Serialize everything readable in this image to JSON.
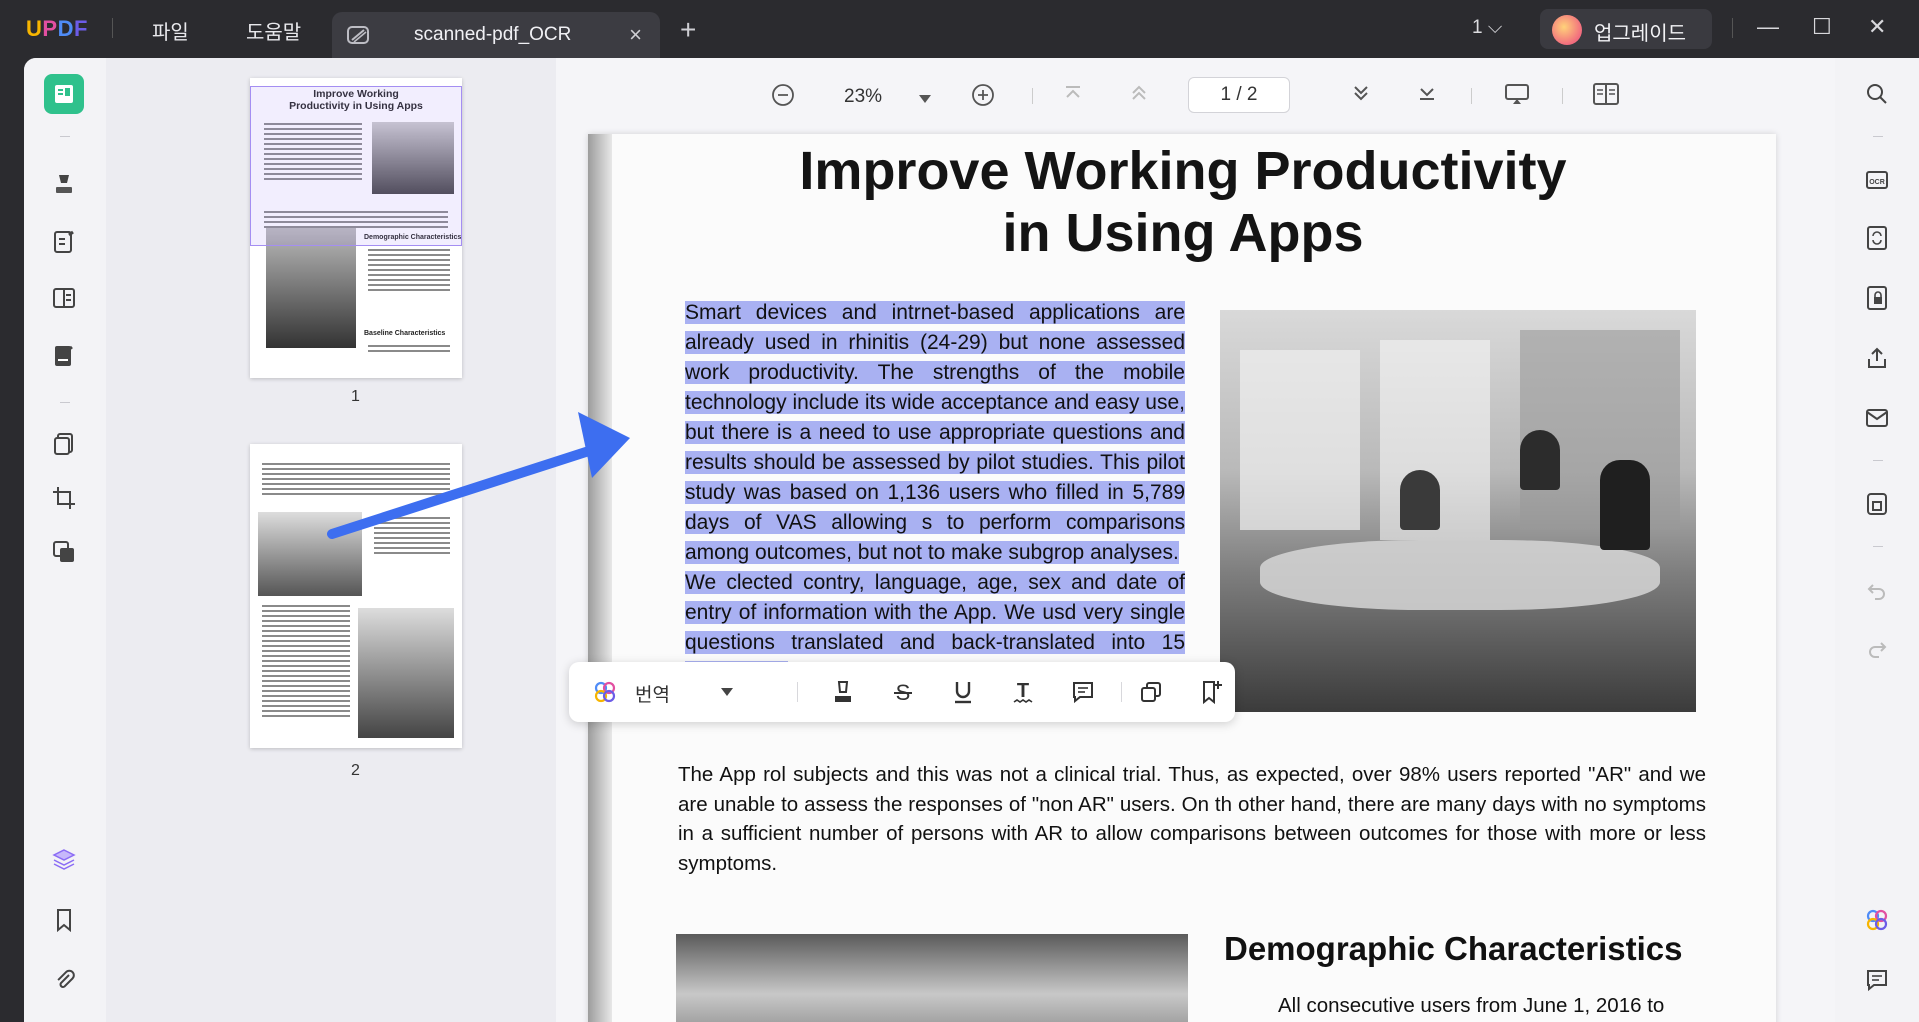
{
  "titlebar": {
    "logo": {
      "u": "U",
      "p": "P",
      "d": "D",
      "f": "F"
    },
    "menu": [
      "파일",
      "도움말"
    ],
    "tab": {
      "name": "scanned-pdf_OCR",
      "close": "×"
    },
    "new_tab": "+",
    "page_selector": "1 ⌵",
    "upgrade": "업그레이드",
    "window": {
      "minimize": "—",
      "maximize": "☐",
      "close": "✕"
    }
  },
  "thumbnails": [
    {
      "label": "1",
      "title": "Improve Working Productivity in Using Apps"
    },
    {
      "label": "2"
    }
  ],
  "thumb_page1": {
    "heading": "Demographic Characteristics",
    "heading2": "Baseline Characteristics"
  },
  "toolbar": {
    "zoom": "23%",
    "page": "1 / 2"
  },
  "document": {
    "title_line1": "Improve Working Productivity",
    "title_line2": "in Using Apps",
    "para1": "Smart devices and intrnet-based applications are already used in rhinitis (24-29) but none assessed work productivity. The strengths of the mobile technology include its wide acceptance and easy use, but there is a need to use appropriate questions and results should be assessed by pilot studies. This pilot study was based on 1,136 users who filled in 5,789 days of VAS allowing s to perform comparisons among outcomes, but not to make subgrop analyses.",
    "para1b": "We clected contry, language, age, sex and date of entry of information with the App. We usd very single questions translated and back-translated into 15 languages.",
    "para2": "The App                                                    rol subjects and this was not a clinical trial. Thus, as expected, over 98% users reported \"AR\" and we are unable to assess the responses of \"non AR\" users. On th other hand, there are many days with no symptoms in a sufficient number of persons with AR to allow comparisons between outcomes for those with more or less symptoms.",
    "heading2": "Demographic Characteristics",
    "subline": "All consecutive users from June 1, 2016 to"
  },
  "floatbar": {
    "translate": "번역"
  },
  "colors": {
    "accent": "#4f6cf7",
    "highlight": "#a9b1f2",
    "arrow": "#3d6ef0"
  }
}
